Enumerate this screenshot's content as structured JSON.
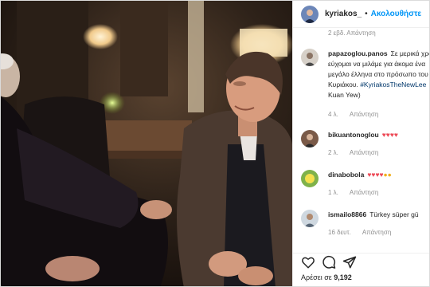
{
  "post": {
    "username": "kyriakos_",
    "follow_label": "Ακολουθήστε",
    "header_separator": "•"
  },
  "comments": {
    "top_stub_time": "2 εβδ.  Απάντηση",
    "items": [
      {
        "username": "papazoglou.panos",
        "lines": [
          "Σε μερικά χρόνια",
          "εύχομαι να μιλάμε για άκομα ένα",
          "μεγάλο έλληνα στο πρόσωπο του",
          "Κυριάκου. "
        ],
        "hashtag": "#KyriakosTheNewLee",
        "tail": "Kuan Yew)",
        "time": "4 λ.",
        "reply": "Απάντηση"
      },
      {
        "username": "bikuantonoglou",
        "emoji": "♥♥♥♥",
        "time": "2 λ.",
        "reply": "Απάντηση"
      },
      {
        "username": "dinabobola",
        "emoji": "♥♥♥♥",
        "emoji_extra": "●●",
        "time": "1 λ.",
        "reply": "Απάντηση"
      },
      {
        "username": "ismailo8866",
        "text": "Türkey süper gü",
        "time": "16 δευτ.",
        "reply": "Απάντηση"
      }
    ]
  },
  "likes": {
    "label": "Αρέσει σε ",
    "count": "9,192"
  },
  "icons": [
    "heart-icon",
    "comment-icon",
    "share-icon"
  ],
  "colors": {
    "link": "#0095f6",
    "hashtag": "#00376b",
    "muted": "#8e8e8e",
    "heart": "#ed4956"
  }
}
